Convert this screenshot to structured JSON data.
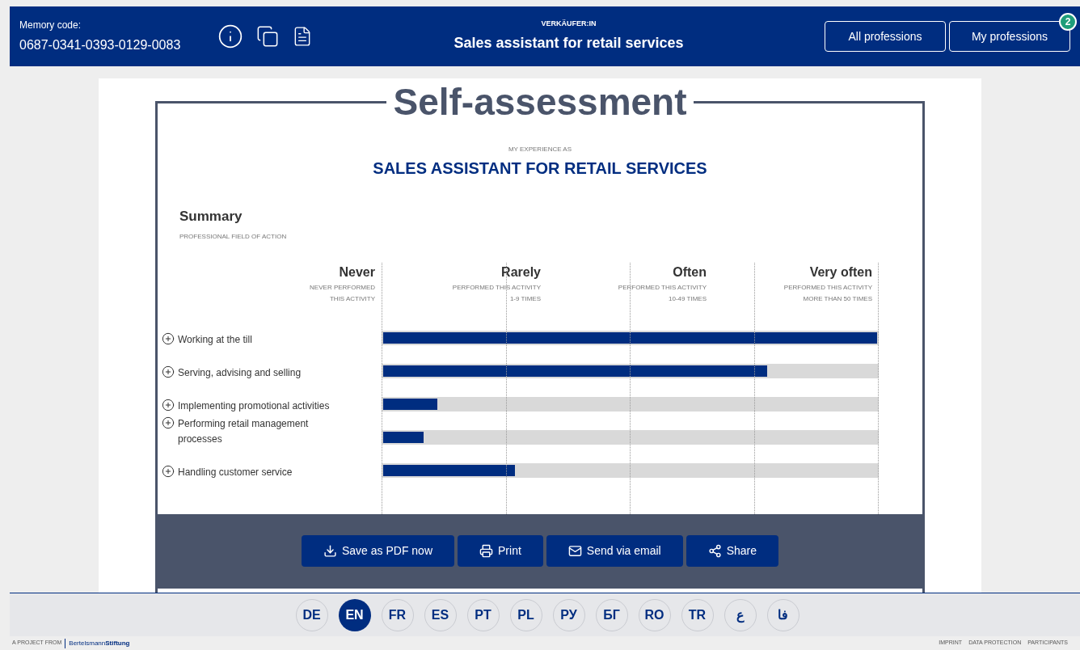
{
  "header": {
    "memory_label": "Memory code:",
    "memory_code": "0687-0341-0393-0129-0083",
    "overline": "VERKÄUFER:IN",
    "title": "Sales assistant for retail services",
    "buttons": [
      {
        "label": "All professions"
      },
      {
        "label": "My professions",
        "badge": "2"
      }
    ]
  },
  "document": {
    "title": "Self-assessment",
    "overline": "MY EXPERIENCE AS",
    "profession": "SALES ASSISTANT FOR RETAIL SERVICES",
    "section_title": "Summary",
    "section_subtitle": "PROFESSIONAL FIELD OF ACTION",
    "scale": [
      {
        "label": "Never",
        "lines": [
          "NEVER PERFORMED",
          "THIS ACTIVITY"
        ]
      },
      {
        "label": "Rarely",
        "lines": [
          "PERFORMED THIS ACTIVITY",
          "1-9 TIMES"
        ]
      },
      {
        "label": "Often",
        "lines": [
          "PERFORMED THIS ACTIVITY",
          "10-49 TIMES"
        ]
      },
      {
        "label": "Very often",
        "lines": [
          "PERFORMED THIS ACTIVITY",
          "MORE THAN 50 TIMES"
        ]
      }
    ],
    "activities": [
      {
        "label": "Working at the till",
        "level": 1.0
      },
      {
        "label": "Serving, advising and selling",
        "level": 0.777
      },
      {
        "label": "Implementing promotional activities",
        "level": 0.11
      },
      {
        "label": "Performing retail management processes",
        "level": 0.082
      },
      {
        "label": "Handling customer service",
        "level": 0.266
      }
    ],
    "actions": [
      {
        "kind": "download",
        "label": "Save as PDF now"
      },
      {
        "kind": "print",
        "label": "Print"
      },
      {
        "kind": "email",
        "label": "Send via email"
      },
      {
        "kind": "share",
        "label": "Share"
      }
    ]
  },
  "languages": [
    {
      "label": "DE",
      "selected": false
    },
    {
      "label": "EN",
      "selected": true
    },
    {
      "label": "FR",
      "selected": false
    },
    {
      "label": "ES",
      "selected": false
    },
    {
      "label": "PT",
      "selected": false
    },
    {
      "label": "PL",
      "selected": false
    },
    {
      "label": "РУ",
      "selected": false
    },
    {
      "label": "БГ",
      "selected": false
    },
    {
      "label": "RO",
      "selected": false
    },
    {
      "label": "TR",
      "selected": false
    },
    {
      "label": "ع",
      "selected": false
    },
    {
      "label": "فا",
      "selected": false
    }
  ],
  "footer": {
    "project_label": "A PROJECT FROM",
    "project_name": "Bertelsmann",
    "project_name_bold": "Stiftung",
    "links": [
      "IMPRINT",
      "DATA PROTECTION",
      "PARTICIPANTS"
    ]
  }
}
